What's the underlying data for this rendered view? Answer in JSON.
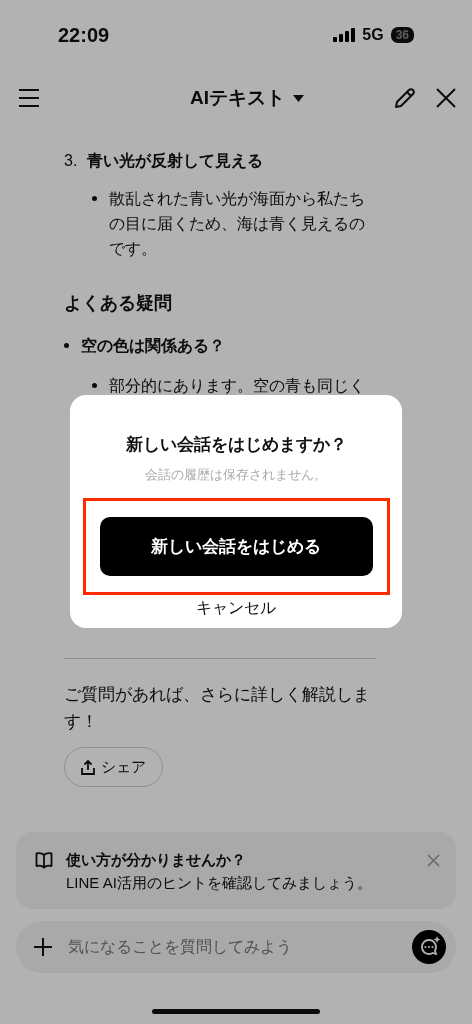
{
  "status_bar": {
    "time": "22:09",
    "network": "5G",
    "battery": "36"
  },
  "header": {
    "title": "AIテキスト"
  },
  "content": {
    "list_item": {
      "number": "3.",
      "title": "青い光が反射して見える",
      "bullet": "散乱された青い光が海面から私たちの目に届くため、海は青く見えるのです。"
    },
    "faq": {
      "heading": "よくある疑問",
      "question": "空の色は関係ある？",
      "answer": "部分的にあります。空の青も同じく"
    },
    "closing": "ご質問があれば、さらに詳しく解説します！",
    "share_button": "シェア"
  },
  "hint": {
    "title": "使い方が分かりませんか？",
    "text": "LINE AI活用のヒントを確認してみましょう。"
  },
  "input": {
    "placeholder": "気になることを質問してみよう"
  },
  "dialog": {
    "title": "新しい会話をはじめますか？",
    "message": "会話の履歴は保存されません。",
    "confirm_button": {
      "label": "新しい会話をはじめる",
      "highlighted": true
    },
    "cancel_button": "キャンセル"
  }
}
